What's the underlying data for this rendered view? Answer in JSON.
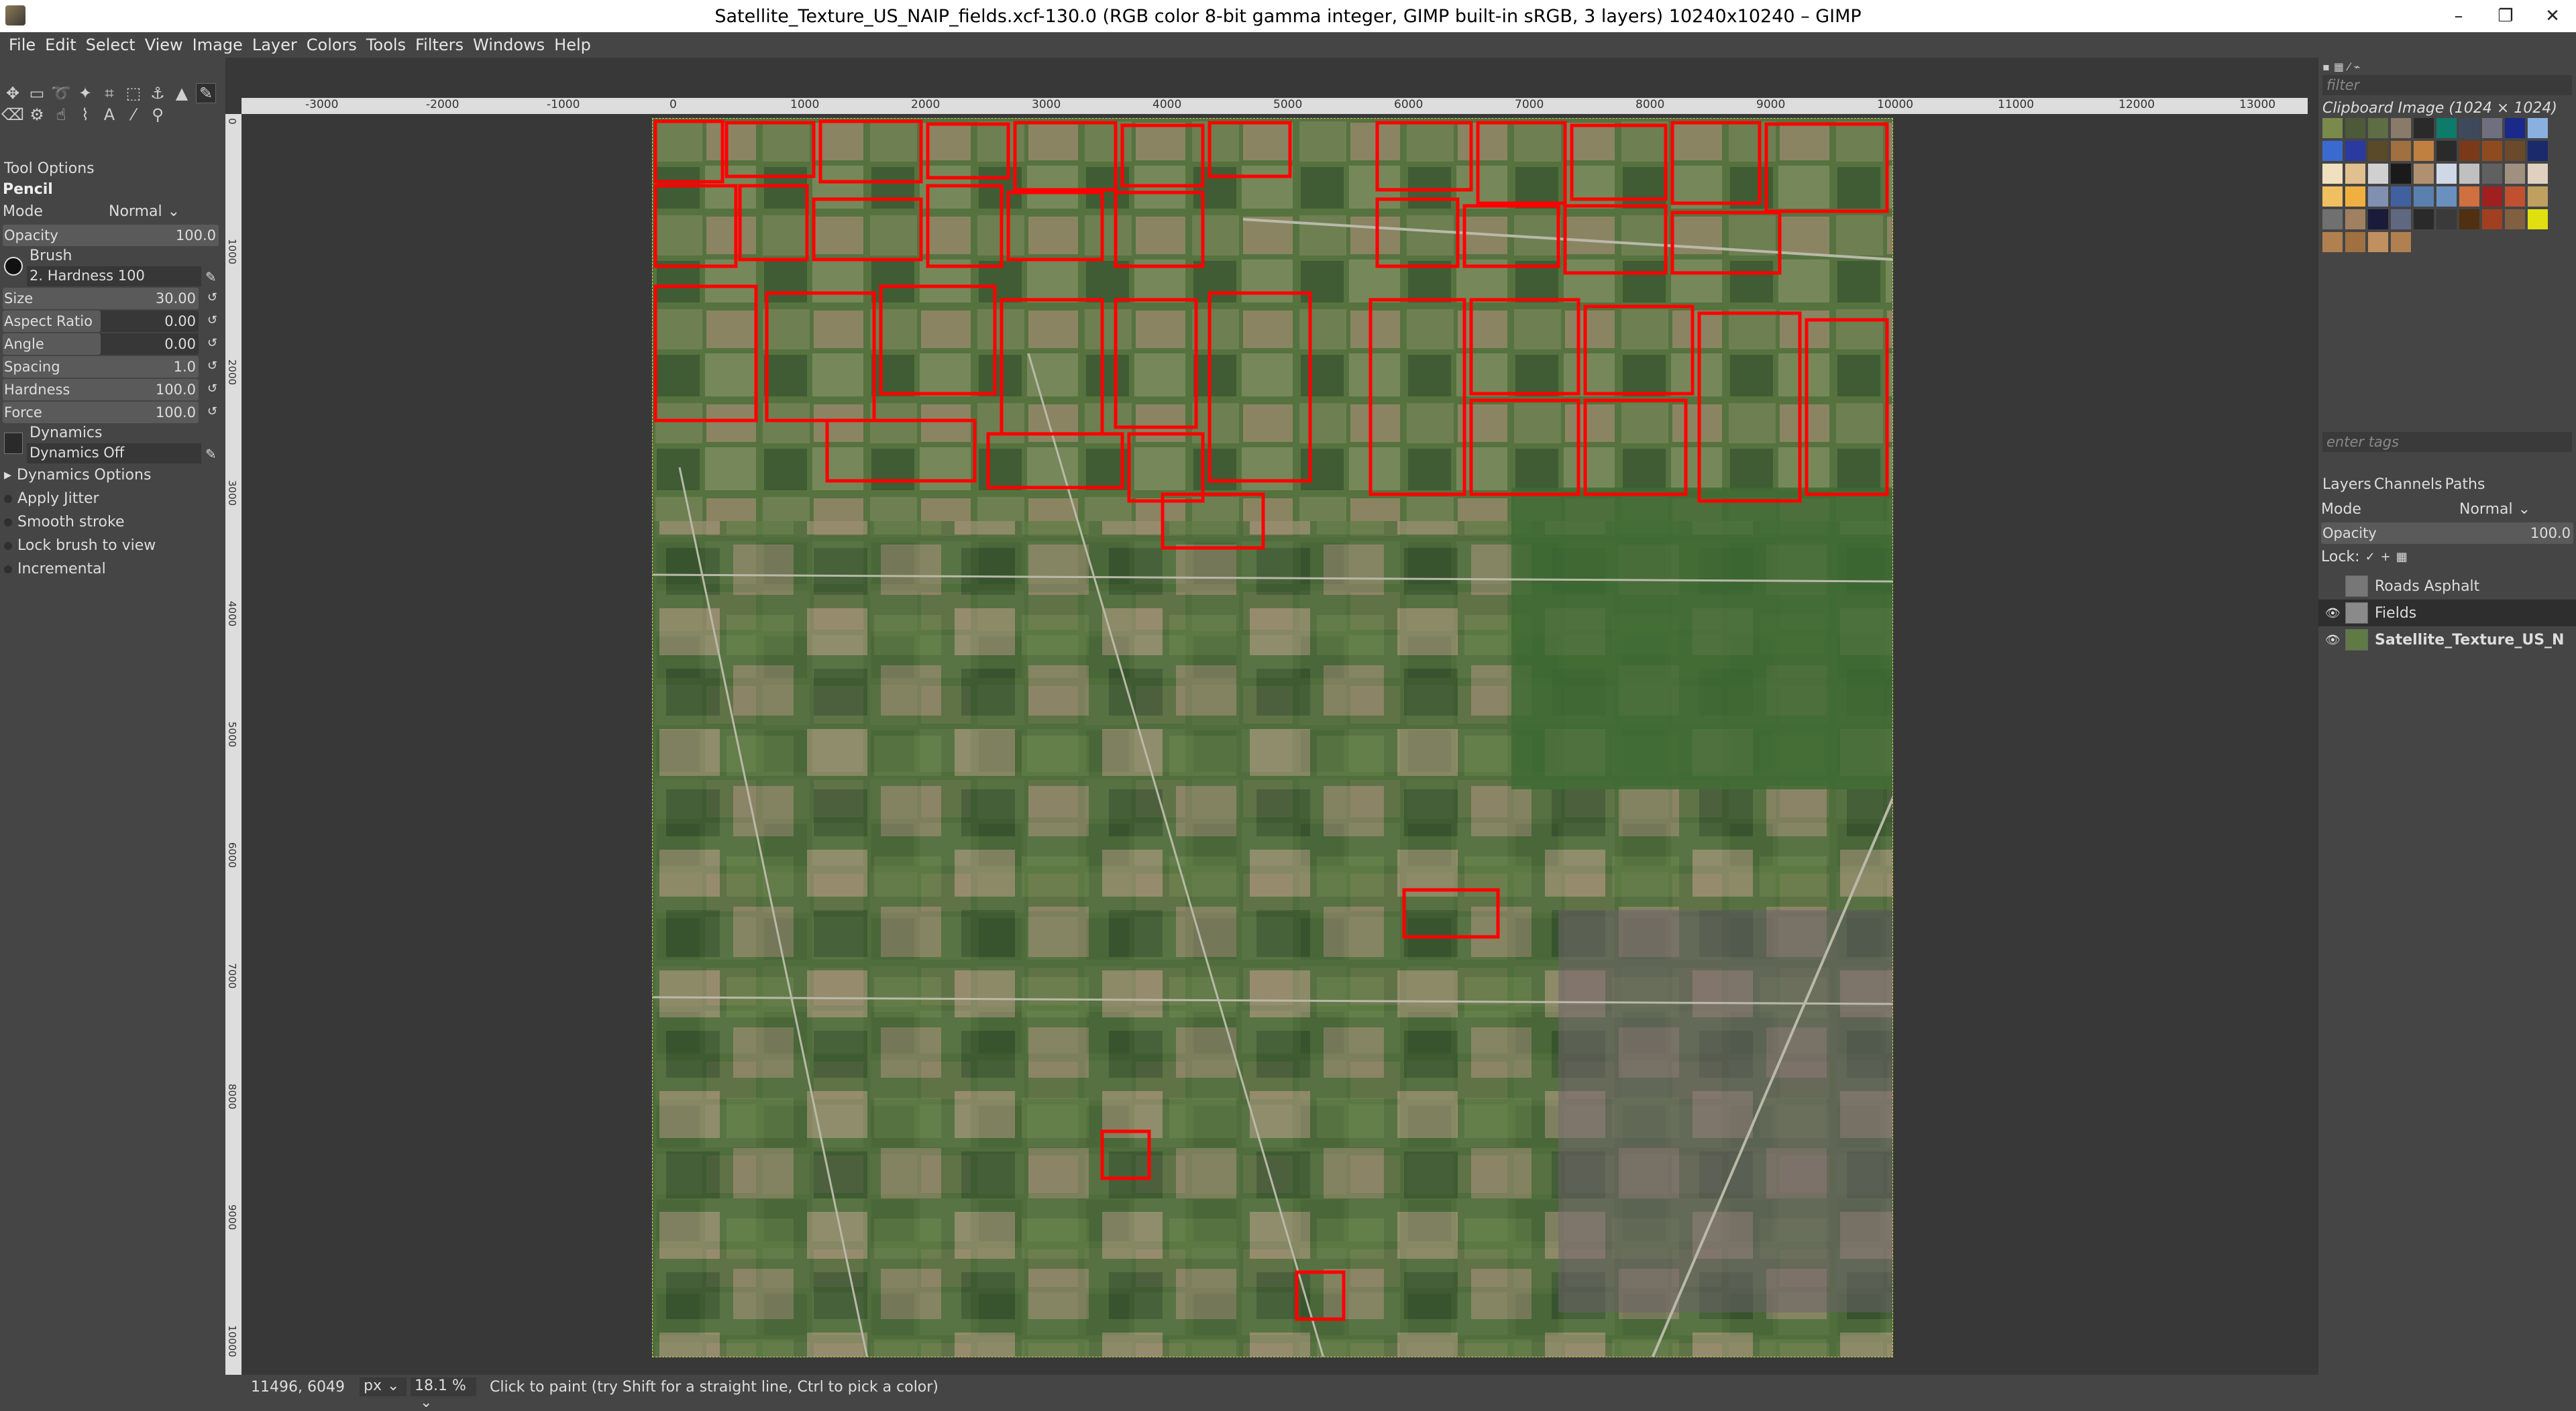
{
  "window": {
    "title": "Satellite_Texture_US_NAIP_fields.xcf-130.0 (RGB color 8-bit gamma integer, GIMP built-in sRGB, 3 layers) 10240x10240 – GIMP",
    "minimize": "–",
    "maximize": "❐",
    "close": "✕"
  },
  "menu": [
    "File",
    "Edit",
    "Select",
    "View",
    "Image",
    "Layer",
    "Colors",
    "Tools",
    "Filters",
    "Windows",
    "Help"
  ],
  "tool_options": {
    "header": "Tool Options",
    "tool_name": "Pencil",
    "mode_label": "Mode",
    "mode_value": "Normal",
    "opacity_label": "Opacity",
    "opacity_value": "100.0",
    "brush_label": "Brush",
    "brush_value": "2. Hardness 100",
    "size_label": "Size",
    "size_value": "30.00",
    "aspect_label": "Aspect Ratio",
    "aspect_value": "0.00",
    "angle_label": "Angle",
    "angle_value": "0.00",
    "spacing_label": "Spacing",
    "spacing_value": "1.0",
    "hardness_label": "Hardness",
    "hardness_value": "100.0",
    "force_label": "Force",
    "force_value": "100.0",
    "dynamics_label": "Dynamics",
    "dynamics_value": "Dynamics Off",
    "dynamics_options": "Dynamics Options",
    "apply_jitter": "Apply Jitter",
    "smooth_stroke": "Smooth stroke",
    "lock_brush": "Lock brush to view",
    "incremental": "Incremental"
  },
  "ruler_h": [
    "-3000",
    "-2000",
    "-1000",
    "0",
    "1000",
    "2000",
    "3000",
    "4000",
    "5000",
    "6000",
    "7000",
    "8000",
    "9000",
    "10000",
    "11000",
    "12000",
    "13000"
  ],
  "ruler_v": [
    "0",
    "1000",
    "2000",
    "3000",
    "4000",
    "5000",
    "6000",
    "7000",
    "8000",
    "9000",
    "10000"
  ],
  "patterns_panel": {
    "filter_placeholder": "filter",
    "selected": "Clipboard Image (1024 × 1024)",
    "tags_placeholder": "enter tags"
  },
  "layers_panel": {
    "tabs": [
      "Layers",
      "Channels",
      "Paths"
    ],
    "mode_label": "Mode",
    "mode_value": "Normal",
    "opacity_label": "Opacity",
    "opacity_value": "100.0",
    "lock_label": "Lock:",
    "layers": [
      {
        "name": "Roads Asphalt",
        "visible": false
      },
      {
        "name": "Fields",
        "visible": true
      },
      {
        "name": "Satellite_Texture_US_N",
        "visible": true
      }
    ]
  },
  "status": {
    "coords": "11496, 6049",
    "unit": "px",
    "zoom": "18.1 %",
    "message": "Click to paint (try Shift for a straight line, Ctrl to pick a color)"
  },
  "colors": {
    "foreground": "#ff0000",
    "background": "#000000",
    "outline": "#ff0000"
  }
}
